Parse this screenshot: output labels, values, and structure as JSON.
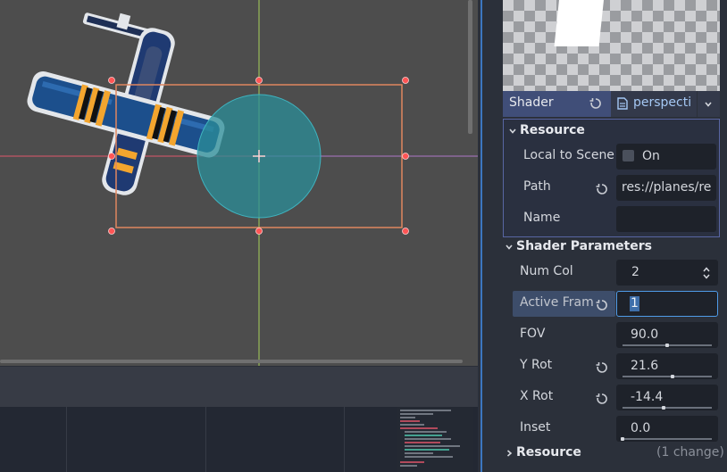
{
  "inspector": {
    "shader": {
      "label": "Shader",
      "resource_name": "perspecti",
      "colors": {
        "header_bg": "#404e78",
        "resource_bg": "#33394a",
        "border": "#5966a3"
      }
    },
    "resource_section": {
      "title": "Resource",
      "local_to_scene": {
        "label": "Local to Scene",
        "value": "On",
        "checked": false
      },
      "path": {
        "label": "Path",
        "value": "res://planes/re"
      },
      "name": {
        "label": "Name",
        "value": ""
      }
    },
    "shader_parameters": {
      "title": "Shader Parameters",
      "num_col": {
        "label": "Num Col",
        "value": "2"
      },
      "active_frame": {
        "label": "Active Fram",
        "value": "1"
      },
      "fov": {
        "label": "FOV",
        "value": "90.0",
        "slider_fraction": 0.5
      },
      "y_rot": {
        "label": "Y Rot",
        "value": "21.6",
        "slider_fraction": 0.56
      },
      "x_rot": {
        "label": "X Rot",
        "value": "-14.4",
        "slider_fraction": 0.46
      },
      "inset": {
        "label": "Inset",
        "value": "0.0",
        "slider_fraction": 0.0
      }
    },
    "footer": {
      "title": "Resource",
      "changes": "(1 change)"
    }
  },
  "colors": {
    "viewport_bg": "#4d4d4d",
    "selection": "#e0865f",
    "handle": "#ff5555",
    "circle": "#2b8e98",
    "axis_x": "#e0566b",
    "axis_y": "#a7d15a",
    "accent": "#4f9be8"
  }
}
